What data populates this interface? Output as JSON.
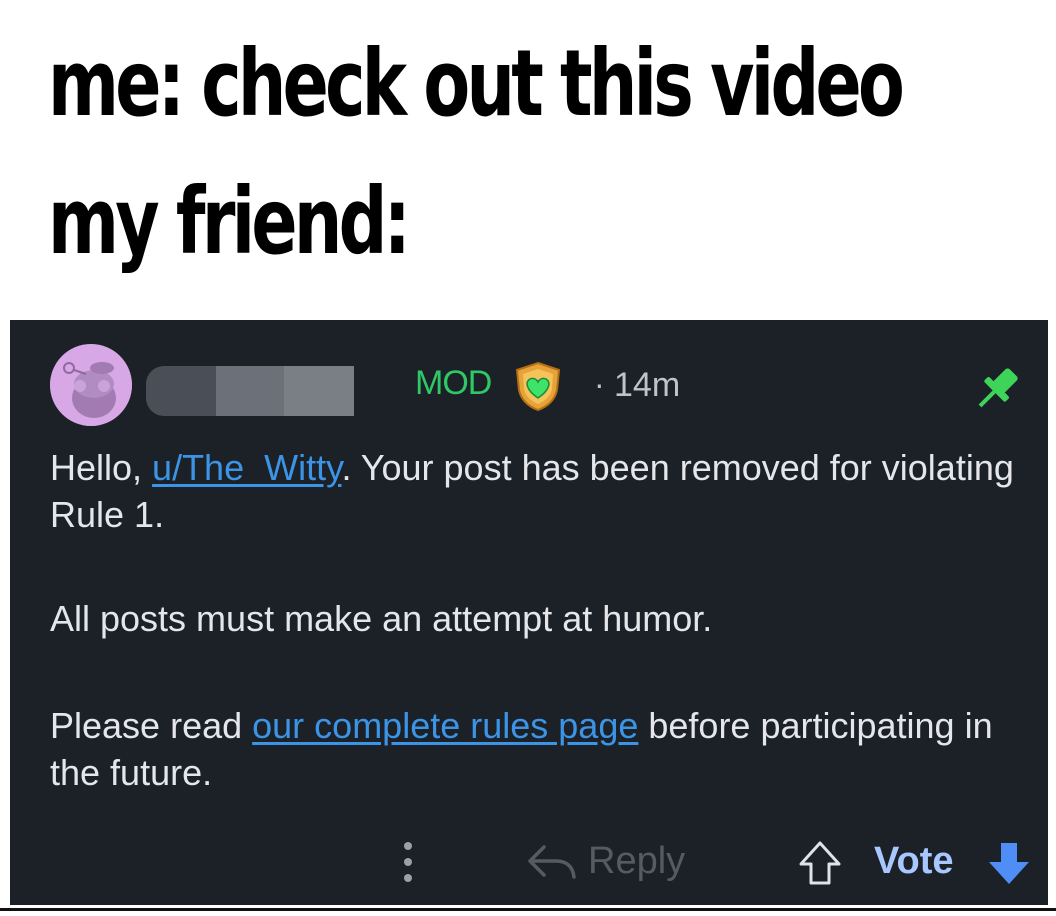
{
  "meme": {
    "line1": "me: check out this video",
    "line2": "my friend:"
  },
  "comment": {
    "author_redacted": true,
    "mod_badge": "MOD",
    "separator": "·",
    "timestamp": "14m",
    "paragraph1": {
      "prefix": "Hello, ",
      "username_link": "u/The_Witty",
      "suffix": ". Your post has been removed for violating Rule 1."
    },
    "paragraph2": "All posts must make an attempt at humor.",
    "paragraph3": {
      "prefix": "Please read ",
      "rules_link": "our complete rules page",
      "suffix": " before participating in the future."
    },
    "actions": {
      "reply_label": "Reply",
      "vote_label": "Vote"
    }
  },
  "colors": {
    "card_bg": "#1c2128",
    "mod_green": "#2ec866",
    "link_blue": "#3c94e6",
    "vote_blue": "#a8c7ff",
    "pin_green": "#3ed45a"
  },
  "icons": [
    "reddit-avatar-icon",
    "mod-shield-icon",
    "pin-icon",
    "more-vertical-icon",
    "reply-icon",
    "upvote-icon",
    "downvote-icon"
  ]
}
